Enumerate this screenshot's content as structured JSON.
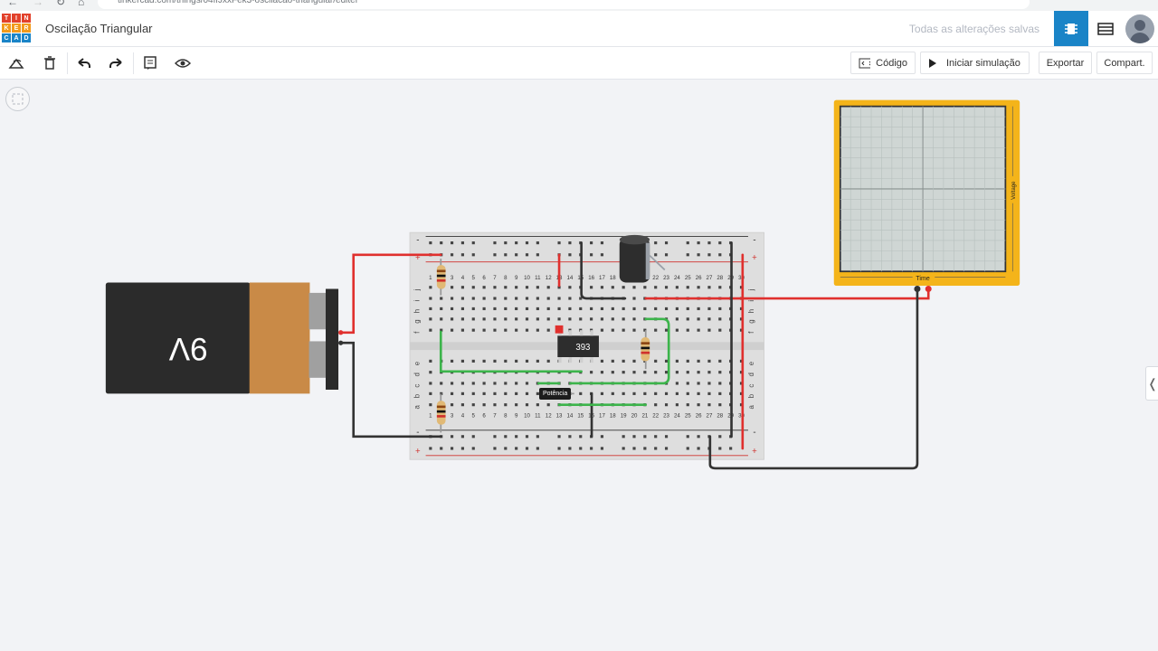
{
  "browser": {
    "url": "tinkercad.com/things/04ffJxxFek3-oscilacao-triangular/editel"
  },
  "app": {
    "logo_letters": [
      "T",
      "I",
      "N",
      "K",
      "E",
      "R",
      "C",
      "A",
      "D"
    ],
    "logo_colors": [
      "#e2412b",
      "#e2412b",
      "#e2412b",
      "#f29a1c",
      "#f29a1c",
      "#f29a1c",
      "#1a84c7",
      "#1a84c7",
      "#1a84c7"
    ],
    "title": "Oscilação Triangular",
    "saved_status": "Todas as alterações salvas"
  },
  "toolbar": {
    "code_label": "Código",
    "sim_label": "Iniciar simulação",
    "export_label": "Exportar",
    "share_label": "Compart."
  },
  "circuit": {
    "battery_label": "9V",
    "chip_label": "393",
    "tooltip": "Potência",
    "scope_x_label": "Time",
    "scope_y_label": "Voltage",
    "row_labels_top": [
      "j",
      "i",
      "h",
      "g",
      "f"
    ],
    "row_labels_bottom": [
      "e",
      "d",
      "c",
      "b",
      "a"
    ],
    "rail_plus": "+",
    "rail_minus": "-",
    "column_numbers": [
      "1",
      "2",
      "3",
      "4",
      "5",
      "6",
      "7",
      "8",
      "9",
      "10",
      "11",
      "12",
      "13",
      "14",
      "15",
      "16",
      "17",
      "18",
      "19",
      "20",
      "21",
      "22",
      "23",
      "24",
      "25",
      "26",
      "27",
      "28",
      "29",
      "30"
    ]
  },
  "colors": {
    "accent": "#1a84c7",
    "wire_red": "#e0302e",
    "wire_black": "#333333",
    "wire_green": "#3cb44b",
    "scope_frame": "#f4b41a"
  }
}
